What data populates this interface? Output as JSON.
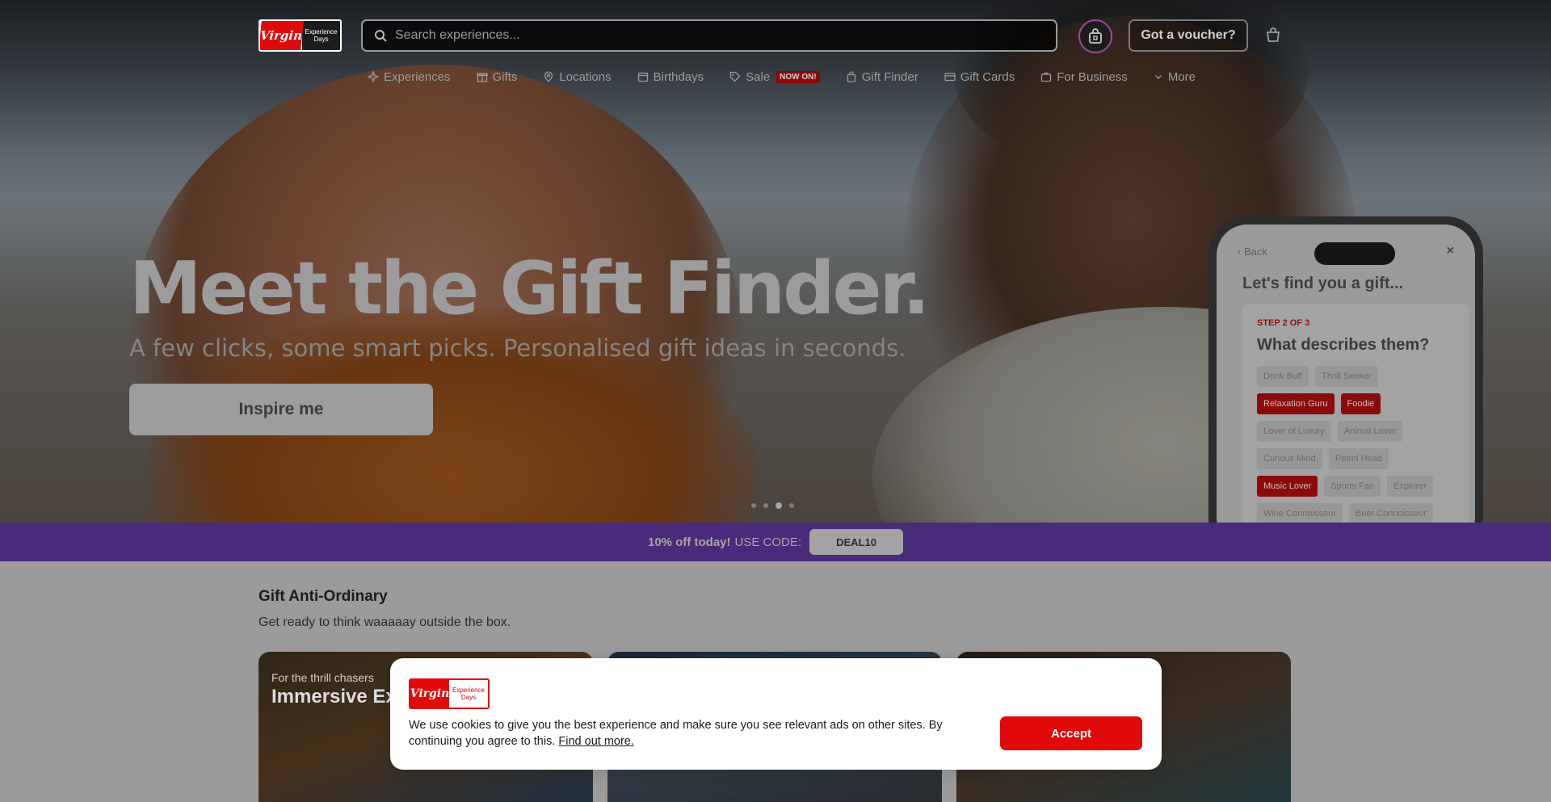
{
  "header": {
    "logo": {
      "mark": "Virgin",
      "line1": "Experience",
      "line2": "Days"
    },
    "search": {
      "placeholder": "Search experiences...",
      "value": ""
    },
    "voucher_label": "Got a voucher?"
  },
  "nav": {
    "items": [
      {
        "label": "Experiences",
        "icon": "sparkle-icon"
      },
      {
        "label": "Gifts",
        "icon": "gift-icon"
      },
      {
        "label": "Locations",
        "icon": "location-pin-icon"
      },
      {
        "label": "Birthdays",
        "icon": "calendar-icon"
      },
      {
        "label": "Sale",
        "icon": "tag-icon",
        "badge": "NOW ON!"
      },
      {
        "label": "Gift Finder",
        "icon": "gift-finder-icon"
      },
      {
        "label": "Gift Cards",
        "icon": "card-icon"
      },
      {
        "label": "For Business",
        "icon": "briefcase-icon"
      },
      {
        "label": "More",
        "icon": "chevron-down-icon"
      }
    ]
  },
  "hero": {
    "headline": "Meet the Gift Finder.",
    "subheadline": "A few clicks, some smart picks. Personalised gift ideas in seconds.",
    "cta_label": "Inspire me",
    "slides_count": 4,
    "active_slide": 3
  },
  "phone": {
    "back_label": "Back",
    "close_label": "×",
    "title": "Let's find you a gift...",
    "step_label": "STEP 2 OF 3",
    "question": "What describes them?",
    "tags": [
      {
        "label": "Drink Buff",
        "selected": false
      },
      {
        "label": "Thrill Seeker",
        "selected": false
      },
      {
        "label": "Relaxation Guru",
        "selected": true
      },
      {
        "label": "Foodie",
        "selected": true
      },
      {
        "label": "Lover of Luxury",
        "selected": false
      },
      {
        "label": "Animal Lover",
        "selected": false
      },
      {
        "label": "Curious Mind",
        "selected": false
      },
      {
        "label": "Petrol Head",
        "selected": false
      },
      {
        "label": "Music Lover",
        "selected": true
      },
      {
        "label": "Sports Fan",
        "selected": false
      },
      {
        "label": "Explorer",
        "selected": false
      },
      {
        "label": "Wine Connoisseur",
        "selected": false
      },
      {
        "label": "Beer Connoisseur",
        "selected": false
      }
    ]
  },
  "promo": {
    "bold": "10% off today!",
    "text": "USE CODE:",
    "code": "DEAL10"
  },
  "section": {
    "title": "Gift Anti-Ordinary",
    "subtitle": "Get ready to think waaaaay outside the box.",
    "tiles": [
      {
        "kicker": "For the thrill chasers",
        "title": "Immersive Experiences"
      },
      {
        "kicker": "",
        "title": ""
      },
      {
        "kicker": "",
        "title": ""
      }
    ]
  },
  "cookie": {
    "logo": {
      "mark": "Virgin",
      "line1": "Experience",
      "line2": "Days"
    },
    "message": "We use cookies to give you the best experience and make sure you see relevant ads on other sites. By continuing you agree to this.",
    "link_label": "Find out more.",
    "accept_label": "Accept"
  },
  "colors": {
    "brand_red": "#e10a0a",
    "promo_purple": "#5b2ea6",
    "gift_button_ring": "#b35cbb"
  }
}
